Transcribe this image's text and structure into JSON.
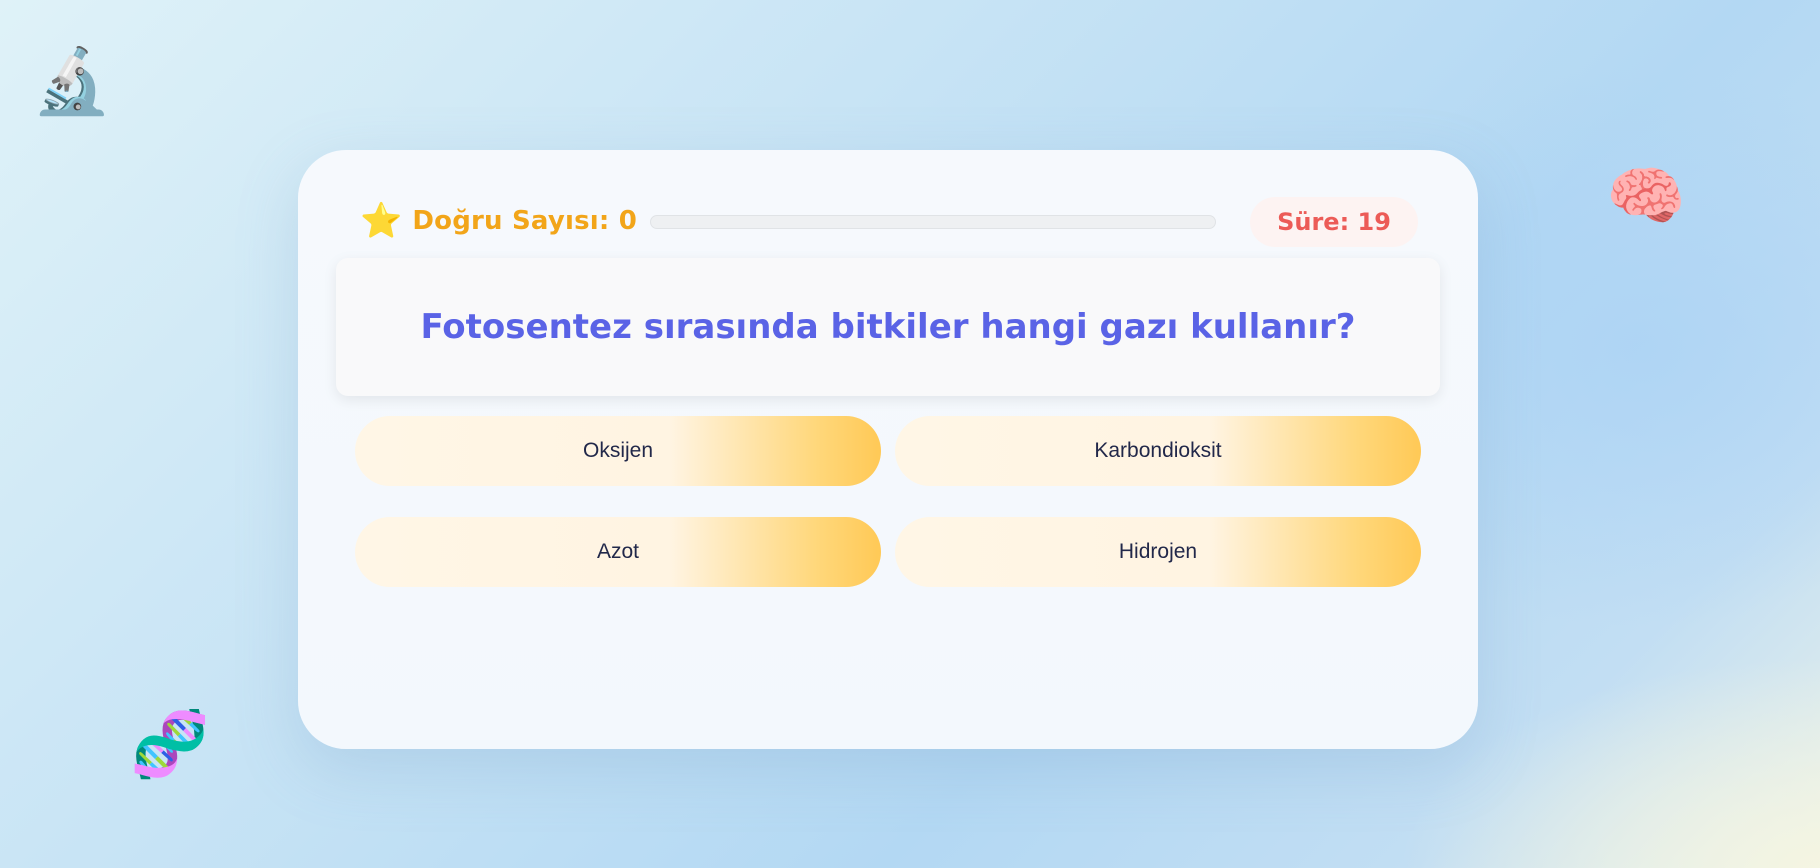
{
  "decorations": {
    "microscope": "🔬",
    "brain": "🧠",
    "dna": "🧬"
  },
  "score": {
    "icon": "⭐",
    "label": "Doğru Sayısı: 0",
    "value": 0
  },
  "progress": {
    "fraction": 0
  },
  "timer": {
    "label": "Süre: 19",
    "value": 19
  },
  "question": {
    "text": "Fotosentez sırasında bitkiler hangi gazı kullanır?"
  },
  "answers": [
    {
      "label": "Oksijen"
    },
    {
      "label": "Karbondioksit"
    },
    {
      "label": "Azot"
    },
    {
      "label": "Hidrojen"
    }
  ],
  "colors": {
    "score": "#f2a519",
    "timer": "#ec5b57",
    "question": "#5a63e6",
    "answer_text": "#22284a",
    "answer_gradient_end": "#ffc956"
  }
}
